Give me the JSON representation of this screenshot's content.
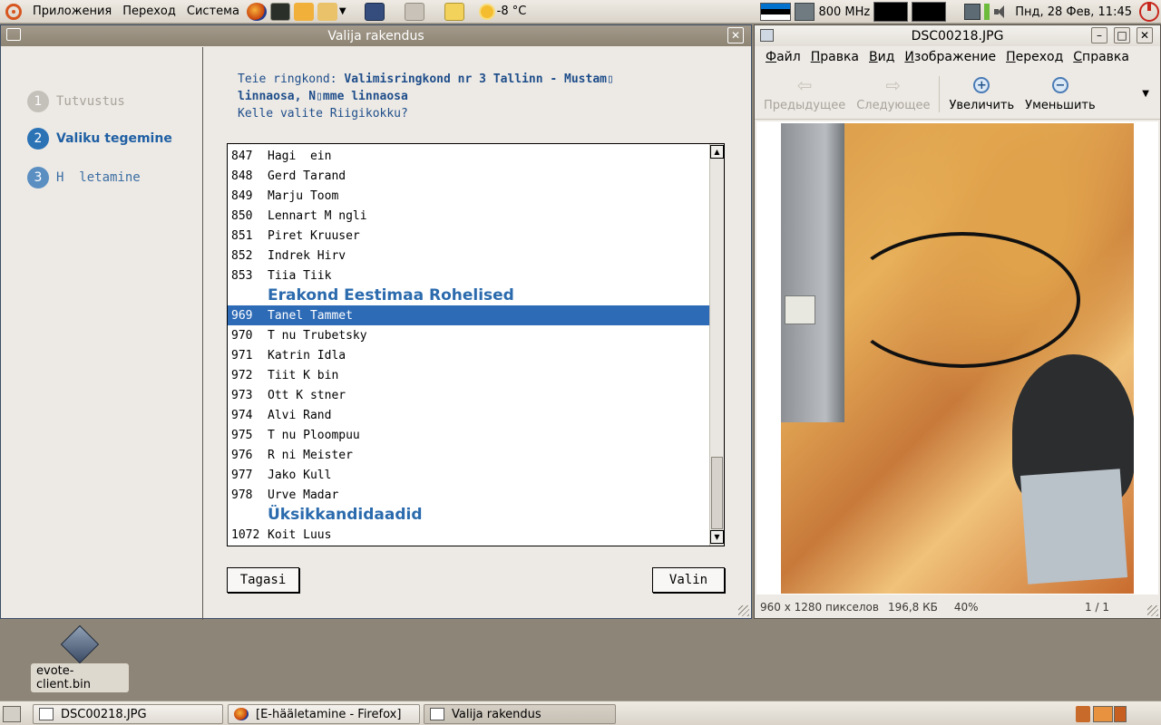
{
  "top_panel": {
    "menus": [
      "Приложения",
      "Переход",
      "Система"
    ],
    "weather": "-8 °C",
    "cpu": "800 MHz",
    "clock": "Пнд, 28 Фев, 11:45"
  },
  "valija": {
    "title": "Valija rakendus",
    "steps": [
      {
        "num": "1",
        "label": "Tutvustus"
      },
      {
        "num": "2",
        "label": "Valiku tegemine"
      },
      {
        "num": "3",
        "label": "H  letamine"
      }
    ],
    "prompt_prefix": "Teie ringkond: ",
    "prompt_district_line1": "Valimisringkond nr 3 Tallinn - Mustam▯",
    "prompt_district_line2": "linnaosa, N▯mme linnaosa",
    "prompt_question": "Kelle valite Riigikokku?",
    "rows": [
      {
        "num": "847",
        "name": "Hagi  ein"
      },
      {
        "num": "848",
        "name": "Gerd Tarand"
      },
      {
        "num": "849",
        "name": "Marju Toom"
      },
      {
        "num": "850",
        "name": "Lennart M ngli"
      },
      {
        "num": "851",
        "name": "Piret Kruuser"
      },
      {
        "num": "852",
        "name": "Indrek Hirv"
      },
      {
        "num": "853",
        "name": "Tiia Tiik"
      }
    ],
    "party_green": "Erakond Eestimaa Rohelised",
    "rows_green": [
      {
        "num": "969",
        "name": "Tanel Tammet"
      },
      {
        "num": "970",
        "name": "T nu Trubetsky"
      },
      {
        "num": "971",
        "name": "Katrin Idla"
      },
      {
        "num": "972",
        "name": "Tiit K bin"
      },
      {
        "num": "973",
        "name": "Ott K stner"
      },
      {
        "num": "974",
        "name": "Alvi Rand"
      },
      {
        "num": "975",
        "name": "T nu Ploompuu"
      },
      {
        "num": "976",
        "name": "R ni Meister"
      },
      {
        "num": "977",
        "name": "Jako Kull"
      },
      {
        "num": "978",
        "name": "Urve Madar"
      }
    ],
    "party_single": "Üksikkandidaadid",
    "rows_single": [
      {
        "num": "1072",
        "name": "Koit Luus"
      }
    ],
    "back_button": "Tagasi",
    "choose_button": "Valin"
  },
  "viewer": {
    "title": "DSC00218.JPG",
    "menu": [
      "Файл",
      "Правка",
      "Вид",
      "Изображение",
      "Переход",
      "Справка"
    ],
    "toolbar": {
      "prev": "Предыдущее",
      "next": "Следующее",
      "zoom_in": "Увеличить",
      "zoom_out": "Уменьшить"
    },
    "status_dims": "960 x 1280 пикселов",
    "status_size": "196,8 КБ",
    "status_zoom": "40%",
    "status_page": "1 / 1"
  },
  "desktop": {
    "icon_label": "evote-client.bin"
  },
  "taskbar": {
    "tasks": [
      "DSC00218.JPG",
      "[E-hääletamine - Firefox]",
      "Valija rakendus"
    ]
  },
  "colors": {
    "selection": "#2e6bb6",
    "party_heading": "#2a6aad",
    "flag_blue": "#0072ce",
    "flag_black": "#000000",
    "flag_white": "#ffffff"
  }
}
